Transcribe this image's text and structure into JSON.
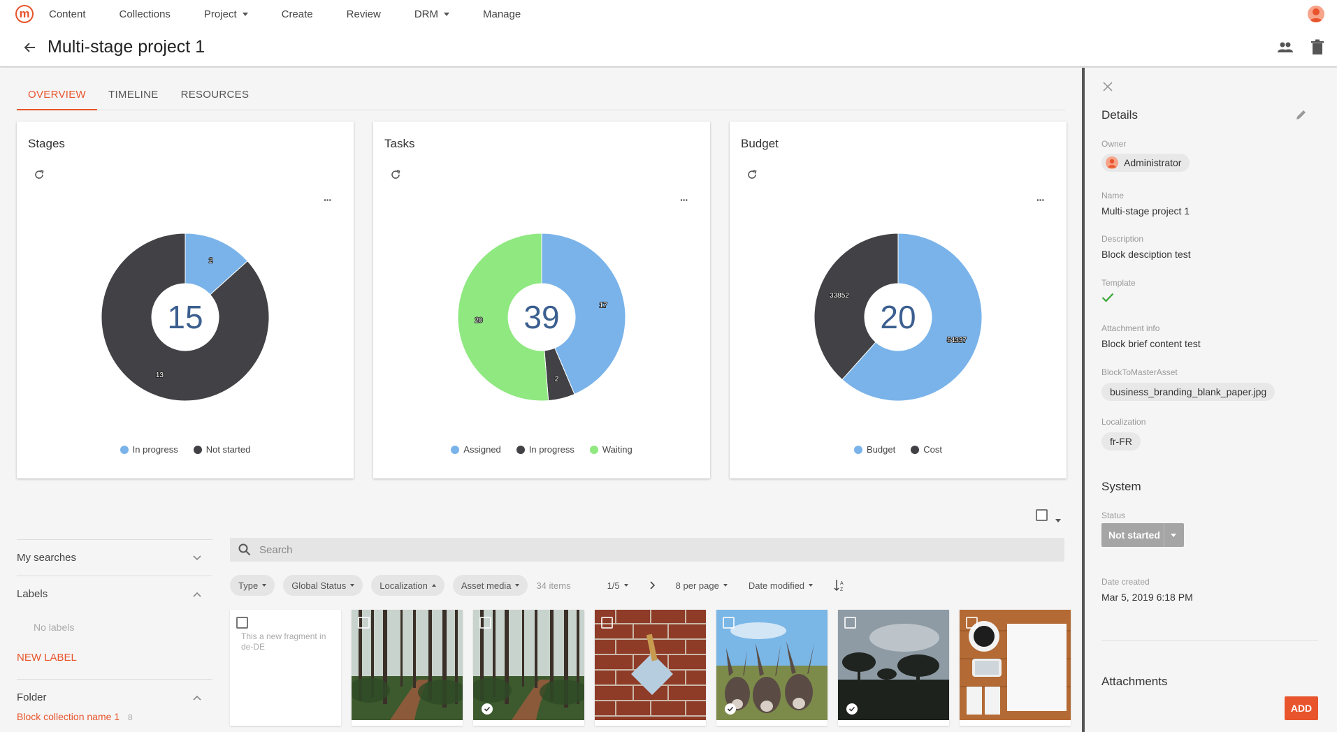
{
  "nav": {
    "logo": "m",
    "items": [
      {
        "label": "Content",
        "dropdown": false
      },
      {
        "label": "Collections",
        "dropdown": false
      },
      {
        "label": "Project",
        "dropdown": true
      },
      {
        "label": "Create",
        "dropdown": false
      },
      {
        "label": "Review",
        "dropdown": false
      },
      {
        "label": "DRM",
        "dropdown": true
      },
      {
        "label": "Manage",
        "dropdown": false
      }
    ]
  },
  "header": {
    "title": "Multi-stage project 1"
  },
  "tabs": [
    {
      "label": "OVERVIEW",
      "active": true
    },
    {
      "label": "TIMELINE",
      "active": false
    },
    {
      "label": "RESOURCES",
      "active": false
    }
  ],
  "chart_data": [
    {
      "type": "pie",
      "title": "Stages",
      "total": "15",
      "categories": [
        "In progress",
        "Not started"
      ],
      "values": [
        2,
        13
      ],
      "colors": [
        "#7ab3ea",
        "#414146"
      ]
    },
    {
      "type": "pie",
      "title": "Tasks",
      "total": "39",
      "categories": [
        "Assigned",
        "In progress",
        "Waiting"
      ],
      "values": [
        17,
        2,
        20
      ],
      "colors": [
        "#7ab3ea",
        "#414146",
        "#8fe880"
      ]
    },
    {
      "type": "pie",
      "title": "Budget",
      "total": "20",
      "categories": [
        "Budget",
        "Cost"
      ],
      "values": [
        54337,
        33852
      ],
      "colors": [
        "#7ab3ea",
        "#414146"
      ]
    }
  ],
  "left_panel": {
    "my_searches": "My searches",
    "labels": "Labels",
    "no_labels": "No labels",
    "new_label": "NEW LABEL",
    "folder": "Folder",
    "folder_item": "Block collection name 1",
    "folder_count": "8"
  },
  "search": {
    "placeholder": "Search"
  },
  "filters": {
    "chips": [
      "Type",
      "Global Status",
      "Localization",
      "Asset media"
    ],
    "items_count": "34 items",
    "page": "1/5",
    "per_page": "8 per page",
    "sort": "Date modified"
  },
  "tiles": [
    {
      "kind": "fragment",
      "text": "This a new fragment in de-DE"
    },
    {
      "kind": "forest",
      "status": false
    },
    {
      "kind": "forest",
      "status": true
    },
    {
      "kind": "brick",
      "status": false
    },
    {
      "kind": "donkeys",
      "status": true
    },
    {
      "kind": "field",
      "status": true
    },
    {
      "kind": "desk",
      "status": false
    }
  ],
  "details": {
    "heading": "Details",
    "owner_label": "Owner",
    "owner": "Administrator",
    "name_label": "Name",
    "name": "Multi-stage project 1",
    "description_label": "Description",
    "description": "Block desciption test",
    "template_label": "Template",
    "attachment_info_label": "Attachment info",
    "attachment_info": "Block brief content test",
    "block_to_master_label": "BlockToMasterAsset",
    "block_to_master": "business_branding_blank_paper.jpg",
    "localization_label": "Localization",
    "localization": "fr-FR",
    "system_heading": "System",
    "status_label": "Status",
    "status": "Not started",
    "date_created_label": "Date created",
    "date_created": "Mar 5, 2019 6:18 PM",
    "attachments_heading": "Attachments",
    "add_label": "ADD"
  }
}
